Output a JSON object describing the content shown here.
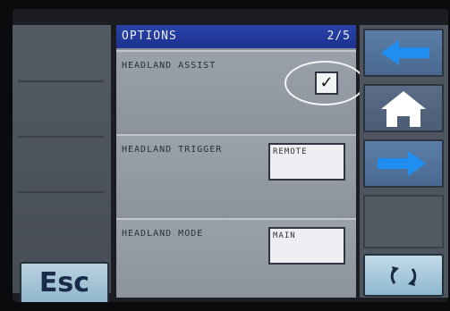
{
  "header": {
    "title": "OPTIONS",
    "page_indicator": "2/5"
  },
  "options": [
    {
      "label": "HEADLAND ASSIST",
      "checked": true,
      "check_glyph": "✓"
    },
    {
      "label": "HEADLAND TRIGGER",
      "value": "REMOTE"
    },
    {
      "label": "HEADLAND MODE",
      "value": "MAIN"
    }
  ],
  "buttons": {
    "esc_label": "Esc",
    "back_icon": "left-arrow-icon",
    "home_icon": "home-icon",
    "forward_icon": "right-arrow-icon",
    "refresh_icon": "refresh-icon"
  },
  "colors": {
    "title_bar": "#1f3596",
    "arrow_fill": "#1f8ef0",
    "home_fill": "#ffffff",
    "esc_button": "#a8c8da"
  }
}
